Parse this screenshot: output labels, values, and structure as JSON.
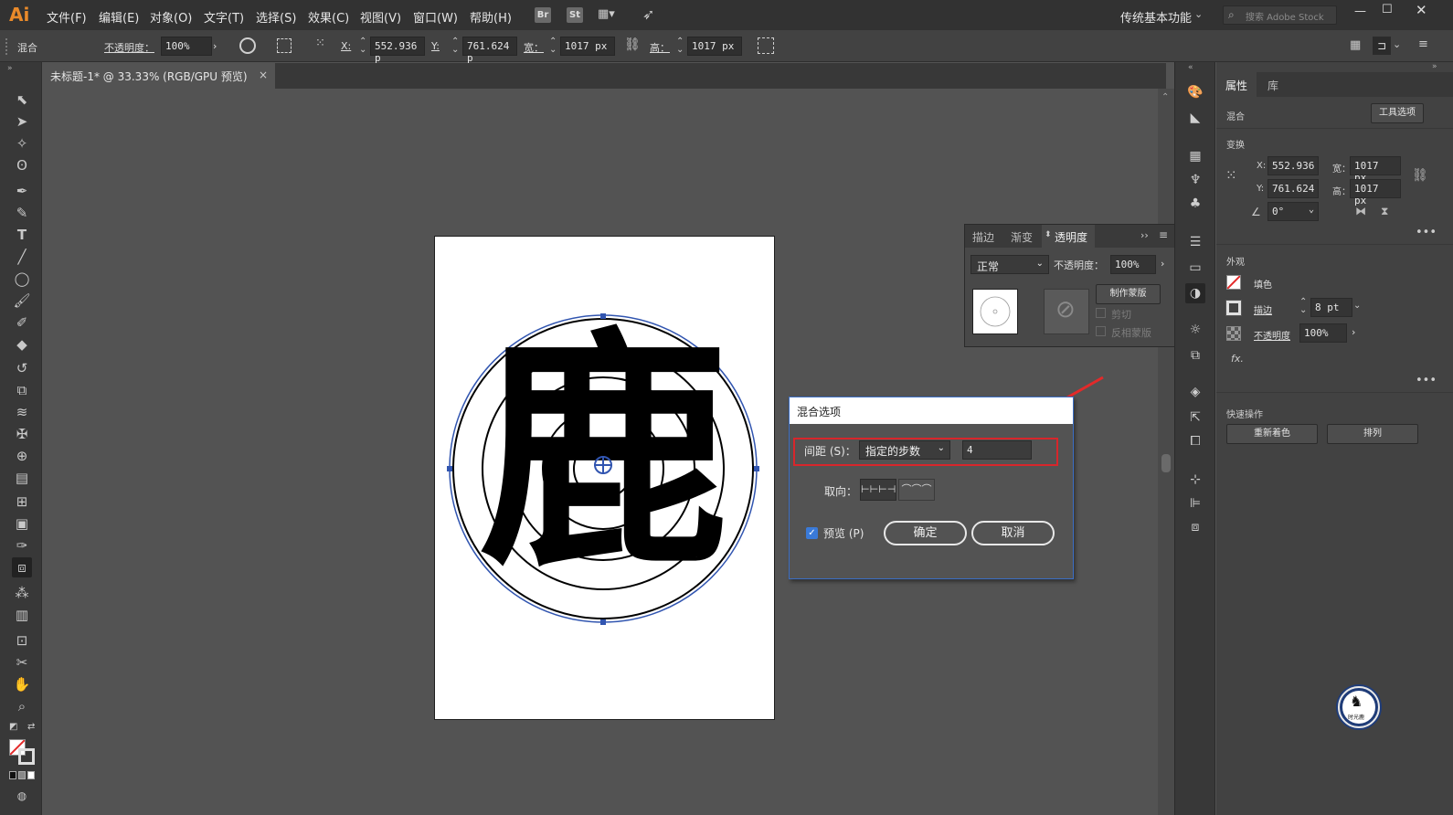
{
  "app": {
    "logo": "Ai",
    "menu": [
      "文件(F)",
      "编辑(E)",
      "对象(O)",
      "文字(T)",
      "选择(S)",
      "效果(C)",
      "视图(V)",
      "窗口(W)",
      "帮助(H)"
    ],
    "chips": [
      "Br",
      "St"
    ],
    "workspace": "传统基本功能",
    "search_placeholder": "搜索 Adobe Stock"
  },
  "control_bar": {
    "object_type": "混合",
    "opacity_label": "不透明度：",
    "opacity_value": "100%",
    "x_label": "X:",
    "x_value": "552.936 p",
    "y_label": "Y:",
    "y_value": "761.624 p",
    "w_label": "宽：",
    "w_value": "1017 px",
    "h_label": "高：",
    "h_value": "1017 px"
  },
  "document_tab": {
    "title": "未标题-1* @ 33.33% (RGB/GPU 预览)",
    "close": "×"
  },
  "artwork": {
    "character": "鹿"
  },
  "transparency_panel": {
    "tabs": [
      "描边",
      "渐变",
      "透明度"
    ],
    "active_tab": "透明度",
    "blend_mode": "正常",
    "opacity_label": "不透明度：",
    "opacity_value": "100%",
    "make_mask_button": "制作蒙版",
    "clip_label": "剪切",
    "invert_mask_label": "反相蒙版"
  },
  "blend_dialog": {
    "title": "混合选项",
    "spacing_label": "间距 (S)：",
    "spacing_mode": "指定的步数",
    "spacing_value": "4",
    "orientation_label": "取向：",
    "preview_label": "预览 (P)",
    "ok_button": "确定",
    "cancel_button": "取消",
    "highlight_color": "#d8262b"
  },
  "properties_panel": {
    "tabs": [
      "属性",
      "库"
    ],
    "active_tab": "属性",
    "object_type": "混合",
    "tool_options_button": "工具选项",
    "transform_title": "变换",
    "x_label": "X:",
    "x_value": "552.936",
    "y_label": "Y:",
    "y_value": "761.624",
    "w_label": "宽：",
    "w_value": "1017 px",
    "h_label": "高：",
    "h_value": "1017 px",
    "angle_value": "0°",
    "appearance_title": "外观",
    "fill_label": "填色",
    "stroke_label": "描边",
    "stroke_value": "8 pt",
    "opacity_label": "不透明度",
    "opacity_value": "100%",
    "fx_label": "fx.",
    "quick_actions_title": "快速操作",
    "recolor_button": "重新着色",
    "arrange_button": "排列"
  },
  "colors": {
    "accent_orange": "#e98a2a",
    "arrow_red": "#e32a2a",
    "dialog_border": "#3b6ec4",
    "selection_blue": "#3155b0",
    "checkbox_blue": "#3a7ad8"
  },
  "watermark_text": "时光鹿"
}
